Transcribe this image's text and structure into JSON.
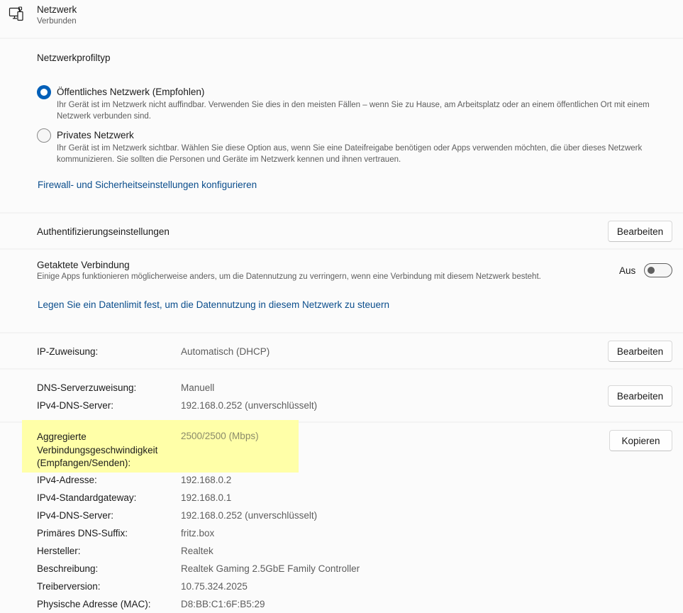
{
  "header": {
    "title": "Netzwerk",
    "status": "Verbunden",
    "icon": "network-monitor-icon"
  },
  "profile": {
    "heading": "Netzwerkprofiltyp",
    "options": [
      {
        "label": "Öffentliches Netzwerk (Empfohlen)",
        "description": "Ihr Gerät ist im Netzwerk nicht auffindbar. Verwenden Sie dies in den meisten Fällen – wenn Sie zu Hause, am Arbeitsplatz oder an einem öffentlichen Ort mit einem Netzwerk verbunden sind.",
        "selected": true
      },
      {
        "label": "Privates Netzwerk",
        "description": "Ihr Gerät ist im Netzwerk sichtbar. Wählen Sie diese Option aus, wenn Sie eine Dateifreigabe benötigen oder Apps verwenden möchten, die über dieses Netzwerk kommunizieren. Sie sollten die Personen und Geräte im Netzwerk kennen und ihnen vertrauen.",
        "selected": false
      }
    ],
    "firewall_link": "Firewall- und Sicherheitseinstellungen konfigurieren"
  },
  "auth": {
    "label": "Authentifizierungseinstellungen",
    "button": "Bearbeiten"
  },
  "metered": {
    "title": "Getaktete Verbindung",
    "description": "Einige Apps funktionieren möglicherweise anders, um die Datennutzung zu verringern, wenn eine Verbindung mit diesem Netzwerk besteht.",
    "toggle_label": "Aus",
    "toggle_on": false,
    "data_limit_link": "Legen Sie ein Datenlimit fest, um die Datennutzung in diesem Netzwerk zu steuern"
  },
  "ip": {
    "label": "IP-Zuweisung:",
    "value": "Automatisch (DHCP)",
    "button": "Bearbeiten"
  },
  "dns": {
    "label": "DNS-Serverzuweisung:",
    "value": "Manuell",
    "server_label": "IPv4-DNS-Server:",
    "server_value": "192.168.0.252 (unverschlüsselt)",
    "button": "Bearbeiten"
  },
  "properties": {
    "copy_button": "Kopieren",
    "speed_label_lines": [
      "Aggregierte",
      "Verbindungsgeschwindigkeit",
      "(Empfangen/Senden):"
    ],
    "speed_value": "2500/2500 (Mbps)",
    "highlight_color": "#ffffa8",
    "rows": [
      {
        "label": "IPv4-Adresse:",
        "value": "192.168.0.2"
      },
      {
        "label": "IPv4-Standardgateway:",
        "value": "192.168.0.1"
      },
      {
        "label": "IPv4-DNS-Server:",
        "value": "192.168.0.252 (unverschlüsselt)"
      },
      {
        "label": "Primäres DNS-Suffix:",
        "value": "fritz.box"
      },
      {
        "label": "Hersteller:",
        "value": "Realtek"
      },
      {
        "label": "Beschreibung:",
        "value": "Realtek Gaming 2.5GbE Family Controller"
      },
      {
        "label": "Treiberversion:",
        "value": "10.75.324.2025"
      },
      {
        "label": "Physische Adresse (MAC):",
        "value": "D8:BB:C1:6F:B5:29"
      }
    ]
  },
  "colors": {
    "accent": "#005fb8",
    "link": "#0a4d8c",
    "card": "#fbfbfb",
    "divider": "#f3f3f3"
  }
}
